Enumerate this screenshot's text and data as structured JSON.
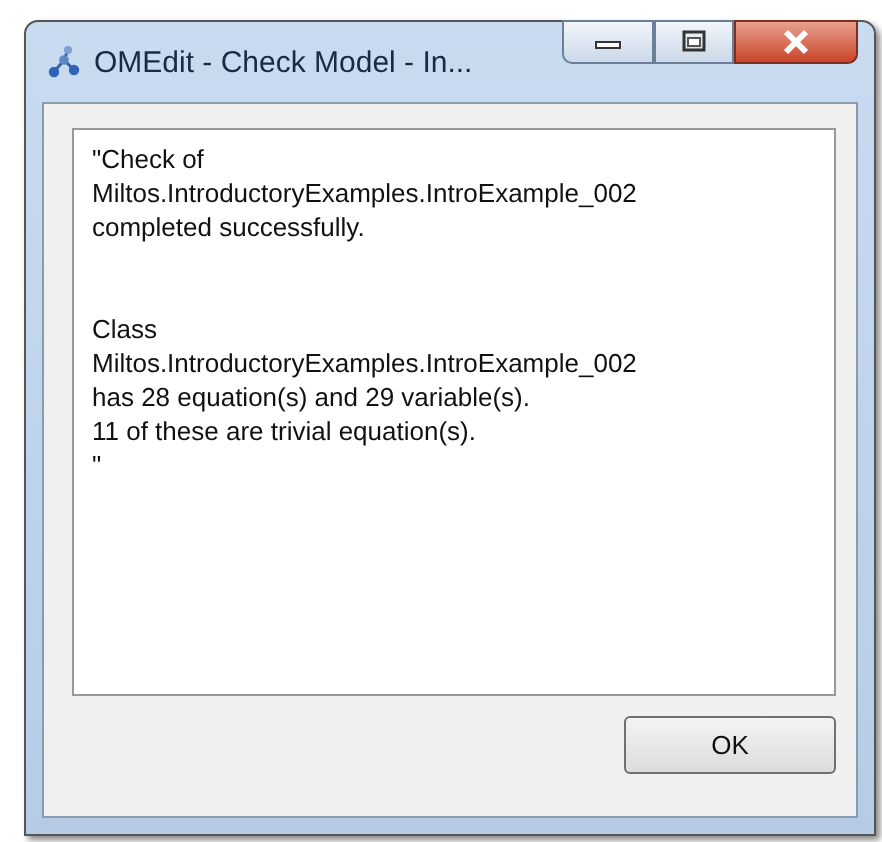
{
  "window": {
    "title": "OMEdit - Check Model - In..."
  },
  "message": [
    {
      "lines": [
        "\"Check of",
        "Miltos.IntroductoryExamples.IntroExample_002",
        "completed successfully."
      ]
    },
    {
      "lines": [
        "Class",
        "Miltos.IntroductoryExamples.IntroExample_002",
        "has 28 equation(s) and 29 variable(s).",
        "11 of these are trivial equation(s).",
        "\""
      ]
    }
  ],
  "buttons": [
    {
      "label": "OK"
    }
  ]
}
